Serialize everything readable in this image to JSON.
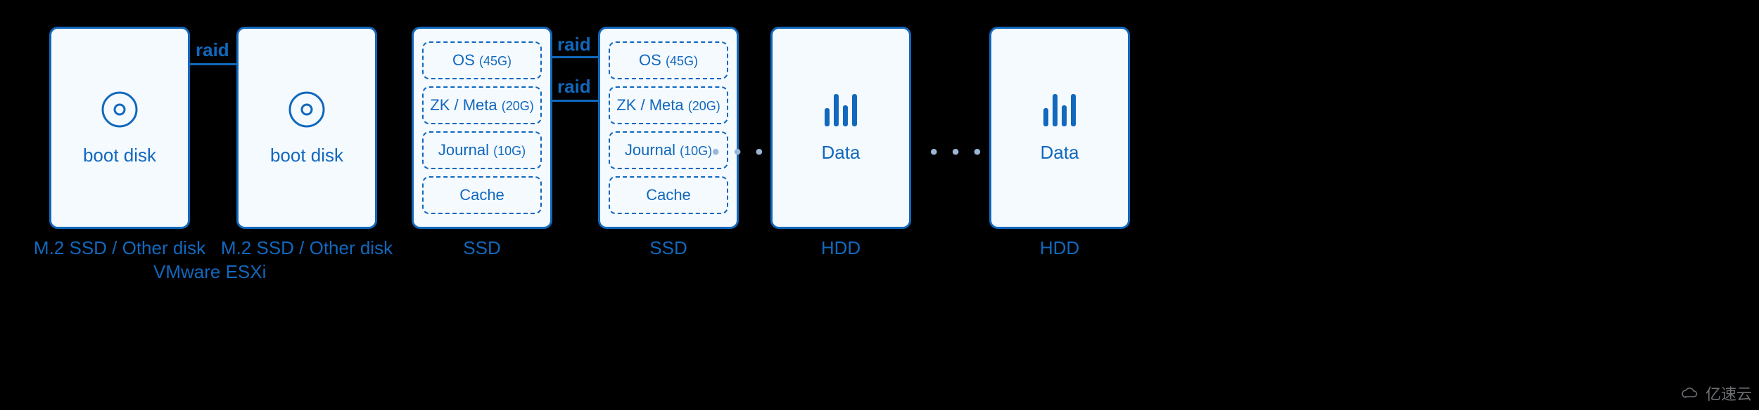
{
  "colors": {
    "accent": "#1168bd",
    "panel_bg": "#f5faff",
    "page_bg": "#000000"
  },
  "boot": {
    "left": {
      "label": "boot disk",
      "caption": "M.2 SSD / Other disk"
    },
    "right": {
      "label": "boot disk",
      "caption": "M.2 SSD / Other disk"
    },
    "raid_label": "raid",
    "subcaption": "VMware ESXi"
  },
  "ssd": {
    "left": {
      "partitions": [
        {
          "name": "OS",
          "size": "(45G)"
        },
        {
          "name": "ZK / Meta",
          "size": "(20G)"
        },
        {
          "name": "Journal",
          "size": "(10G)"
        },
        {
          "name": "Cache",
          "size": ""
        }
      ],
      "caption": "SSD"
    },
    "right": {
      "partitions": [
        {
          "name": "OS",
          "size": "(45G)"
        },
        {
          "name": "ZK / Meta",
          "size": "(20G)"
        },
        {
          "name": "Journal",
          "size": "(10G)"
        },
        {
          "name": "Cache",
          "size": ""
        }
      ],
      "caption": "SSD"
    },
    "raid_labels": {
      "row0": "raid",
      "row1": "raid"
    }
  },
  "hdd": {
    "left": {
      "label": "Data",
      "caption": "HDD"
    },
    "right": {
      "label": "Data",
      "caption": "HDD"
    }
  },
  "ellipsis": "• • •",
  "watermark": "亿速云"
}
